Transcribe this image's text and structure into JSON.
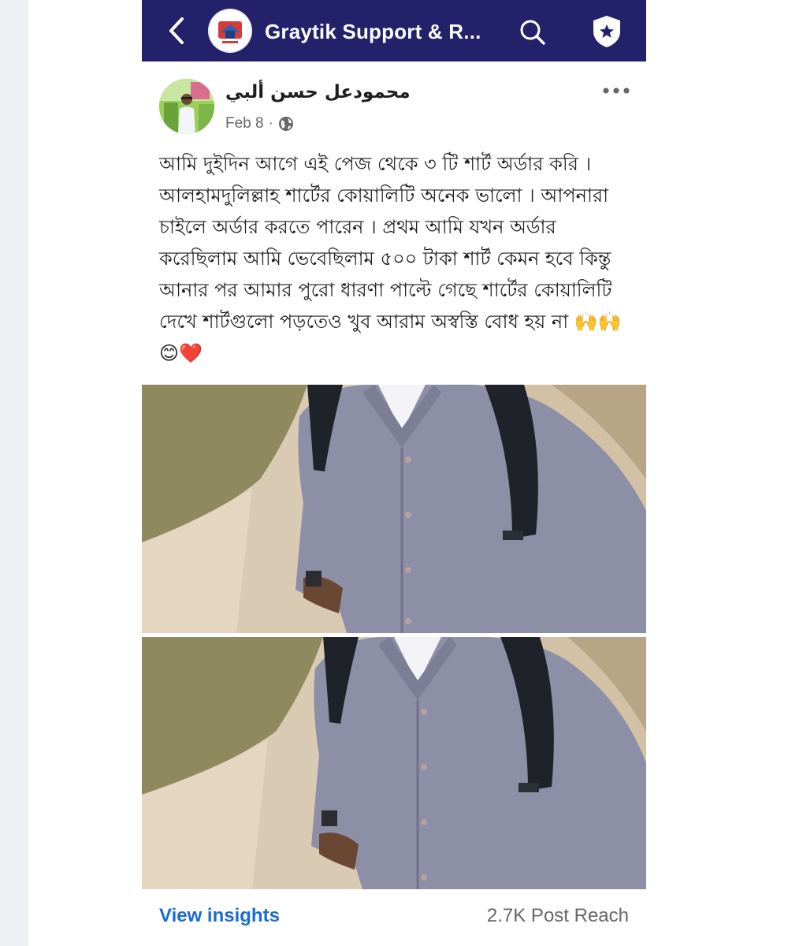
{
  "header": {
    "title": "Graytik Support & R...",
    "back_icon": "chevron-left-icon",
    "search_icon": "search-icon",
    "shield_icon": "shield-star-icon",
    "bar_color": "#24216b"
  },
  "post": {
    "author": "محمودعل حسن ألبي",
    "date": "Feb 8",
    "separator": "·",
    "privacy_icon": "globe-icon",
    "more_icon": "more-horizontal-icon",
    "text": "আমি দুইদিন আগে এই পেজ থেকে ৩ টি  শার্ট অর্ডার করি । আলহামদুলিল্লাহ শার্টের কোয়ালিটি অনেক ভালো । আপনারা চাইলে অর্ডার করতে পারেন । প্রথম আমি যখন অর্ডার করেছিলাম আমি ভেবেছিলাম ৫০০ টাকা শার্ট কেমন হবে কিন্তু আনার পর আমার পুরো ধারণা পাল্টে গেছে শার্টের কোয়ালিটি দেখে শার্টগুলো পড়তেও খুব আরাম অস্বস্তি বোধ হয় না 🙌🙌😊❤️"
  },
  "footer": {
    "insights_label": "View insights",
    "reach_label": "2.7K Post Reach",
    "link_color": "#1b6cd1"
  }
}
